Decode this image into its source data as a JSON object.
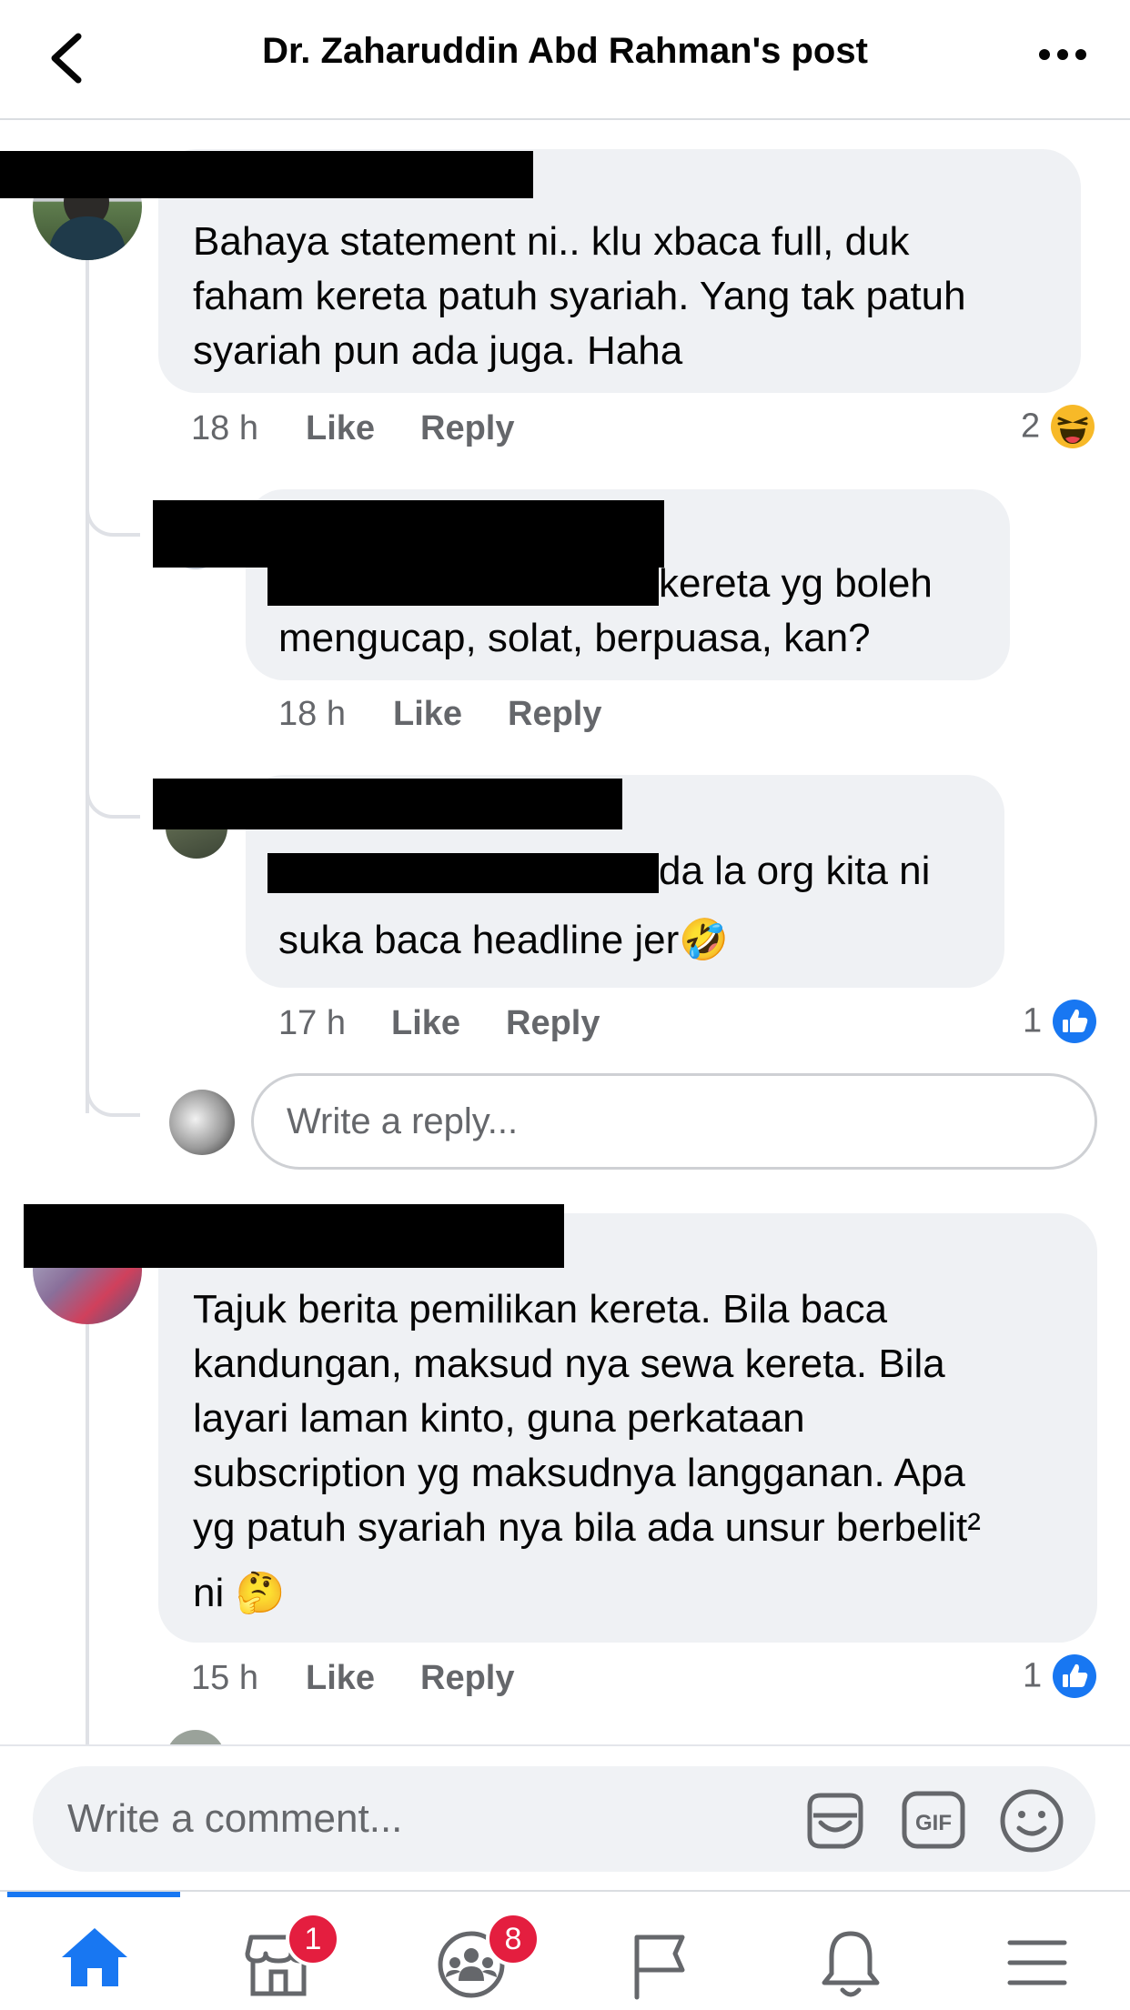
{
  "header": {
    "title": "Dr. Zaharuddin Abd Rahman's post"
  },
  "comments": [
    {
      "text_lines": [
        "Bahaya statement ni.. klu xbaca full, duk",
        "faham kereta patuh syariah. Yang tak patuh",
        "syariah pun ada juga. Haha"
      ],
      "time": "18 h",
      "like": "Like",
      "reply": "Reply",
      "reaction_count": "2",
      "reaction_icon": "haha-reaction-icon",
      "replies": [
        {
          "text_line1": "kereta yg boleh",
          "text_line2": "mengucap, solat, berpuasa, kan?",
          "time": "18 h",
          "like": "Like",
          "reply": "Reply"
        },
        {
          "text_line1": "da la org kita ni",
          "text_line2": "suka baca headline jer",
          "emoji": "🤣",
          "time": "17 h",
          "like": "Like",
          "reply": "Reply",
          "reaction_count": "1",
          "reaction_icon": "like-reaction-icon"
        }
      ],
      "write_reply_placeholder": "Write a reply..."
    },
    {
      "text_lines": [
        "Tajuk berita pemilikan kereta. Bila baca",
        "kandungan, maksud nya sewa kereta. Bila",
        "layari laman kinto, guna perkataan",
        "subscription yg maksudnya langganan. Apa",
        "yg patuh syariah nya bila ada unsur berbelit²"
      ],
      "last_line": "ni",
      "emoji": "🤔",
      "time": "15 h",
      "like": "Like",
      "reply": "Reply",
      "reaction_count": "1",
      "reaction_icon": "like-reaction-icon"
    }
  ],
  "composer": {
    "placeholder": "Write a comment..."
  },
  "tabbar": {
    "marketplace_badge": "1",
    "groups_badge": "8"
  },
  "colors": {
    "accent": "#1877f2",
    "badge": "#e41e3f",
    "bubble": "#eff1f4",
    "meta_text": "#65676b"
  }
}
